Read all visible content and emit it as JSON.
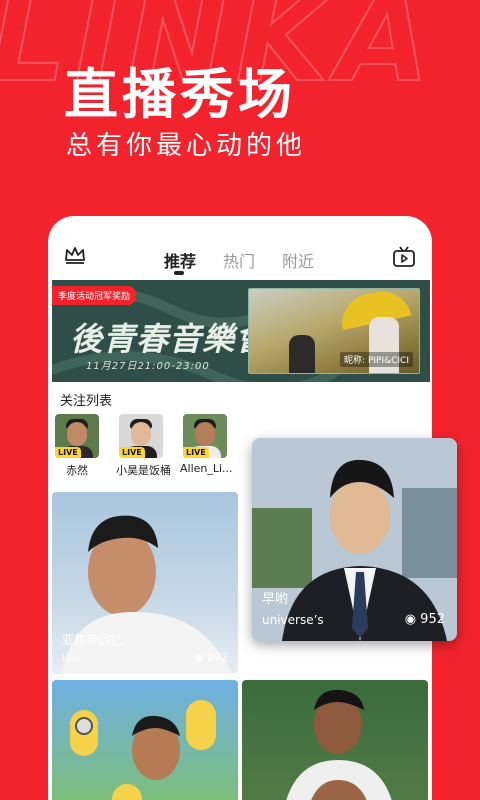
{
  "hero": {
    "title": "直播秀场",
    "subtitle": "总有你最心动的他"
  },
  "tabs": [
    {
      "label": "推荐",
      "active": true
    },
    {
      "label": "热门",
      "active": false
    },
    {
      "label": "附近",
      "active": false
    }
  ],
  "icons": {
    "left": "crown-icon",
    "right": "tv-play-icon",
    "views": "eye-icon"
  },
  "banner": {
    "tag": "季度活动冠军奖励",
    "title": "後青春音樂會",
    "time": "11月27日21:00-23:00",
    "credit": "昵称: PIPI&CICI"
  },
  "follow": {
    "label": "关注列表",
    "items": [
      {
        "name": "赤然",
        "live": "LIVE"
      },
      {
        "name": "小昊是饭桶",
        "live": "LIVE"
      },
      {
        "name": "Allen_Li...",
        "live": "LIVE"
      }
    ]
  },
  "cards": [
    {
      "title": "亚热带回忆",
      "user": "Liuc",
      "views": "892"
    },
    {
      "title": "",
      "user": "",
      "views": ""
    },
    {
      "title": "",
      "user": "",
      "views": ""
    }
  ],
  "featured": {
    "title": "早哟",
    "user": "universe’s",
    "views": "952"
  },
  "colors": {
    "brand_red": "#f2232d",
    "live_yellow": "#ffd52a"
  }
}
